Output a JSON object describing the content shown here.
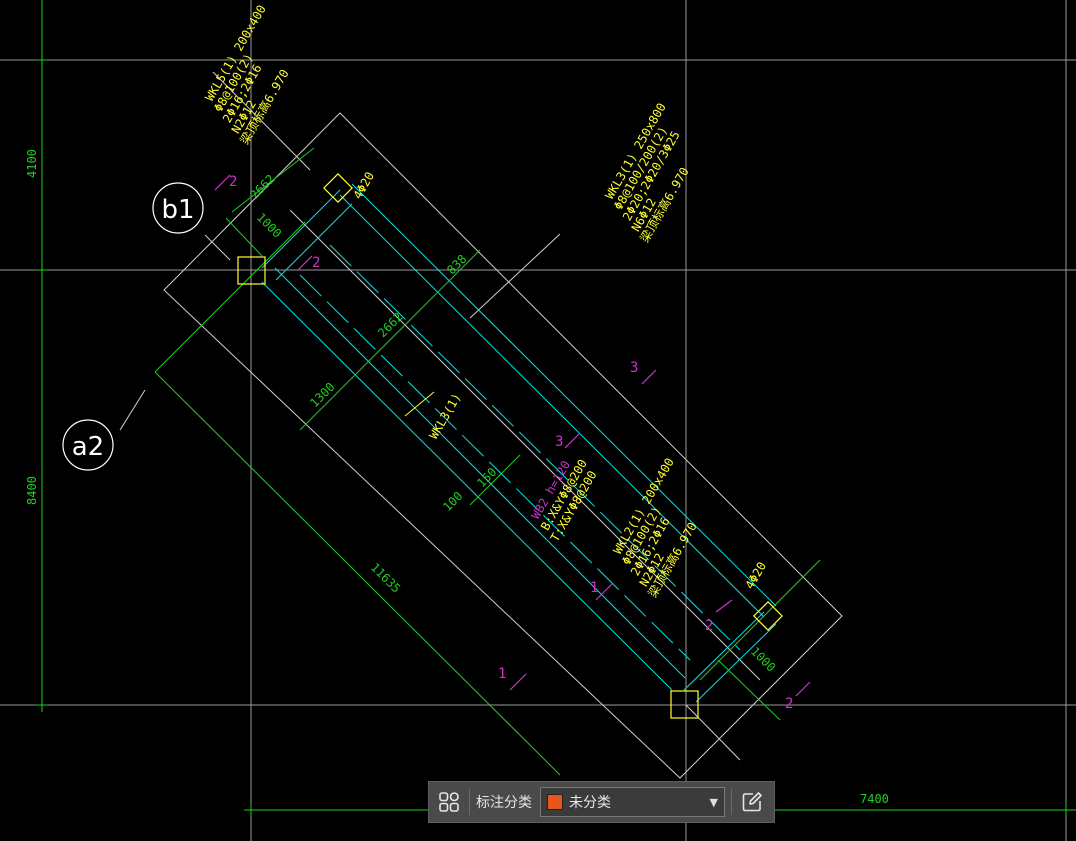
{
  "drawing": {
    "beam_wkl5": [
      "WKL5(1) 200x400",
      "Φ8@100(2)",
      "2Φ16;2Φ16",
      "N2Φ12",
      "梁顶标高6.970"
    ],
    "beam_wkl3": [
      "WKL3(1) 250x800",
      "Φ8@100/200(2)",
      "2Φ20;2Φ20/3Φ25",
      "N6Φ12",
      "梁顶标高6.970"
    ],
    "beam_wkl2": [
      "WKL2(1) 200x400",
      "Φ8@100(2)",
      "2Φ16;2Φ16",
      "N2Φ12",
      "梁顶标高6.970"
    ],
    "slab": [
      "WB2  h=120",
      "B:X&YΦ8@200",
      "T:X&YΦ8@200"
    ],
    "beam_mid_label": "WKL3(1)",
    "rebar_top": "4Φ20",
    "rebar_bottom": "4Φ20",
    "dims": {
      "d2662a": "2662",
      "d1000a": "1000",
      "d838": "838",
      "d2662b": "2662",
      "d1300": "1300",
      "d150": "150",
      "d100": "100",
      "d11635": "11635",
      "d1000b": "1000",
      "d4100": "4100",
      "d8400": "8400",
      "d7400": "7400"
    },
    "section_marks": [
      "2",
      "2",
      "3",
      "3",
      "1",
      "1",
      "2",
      "2"
    ],
    "axis_b1": "b1",
    "axis_a2": "a2"
  },
  "toolbar": {
    "label": "标注分类",
    "selected": "未分类",
    "swatch_color": "#e8561c"
  },
  "colors": {
    "background": "#000000",
    "grid": "#ffffff",
    "dimension": "#22cc22",
    "annotation": "#ffff33",
    "section": "#cc33cc",
    "beam": "#00e5e5"
  }
}
